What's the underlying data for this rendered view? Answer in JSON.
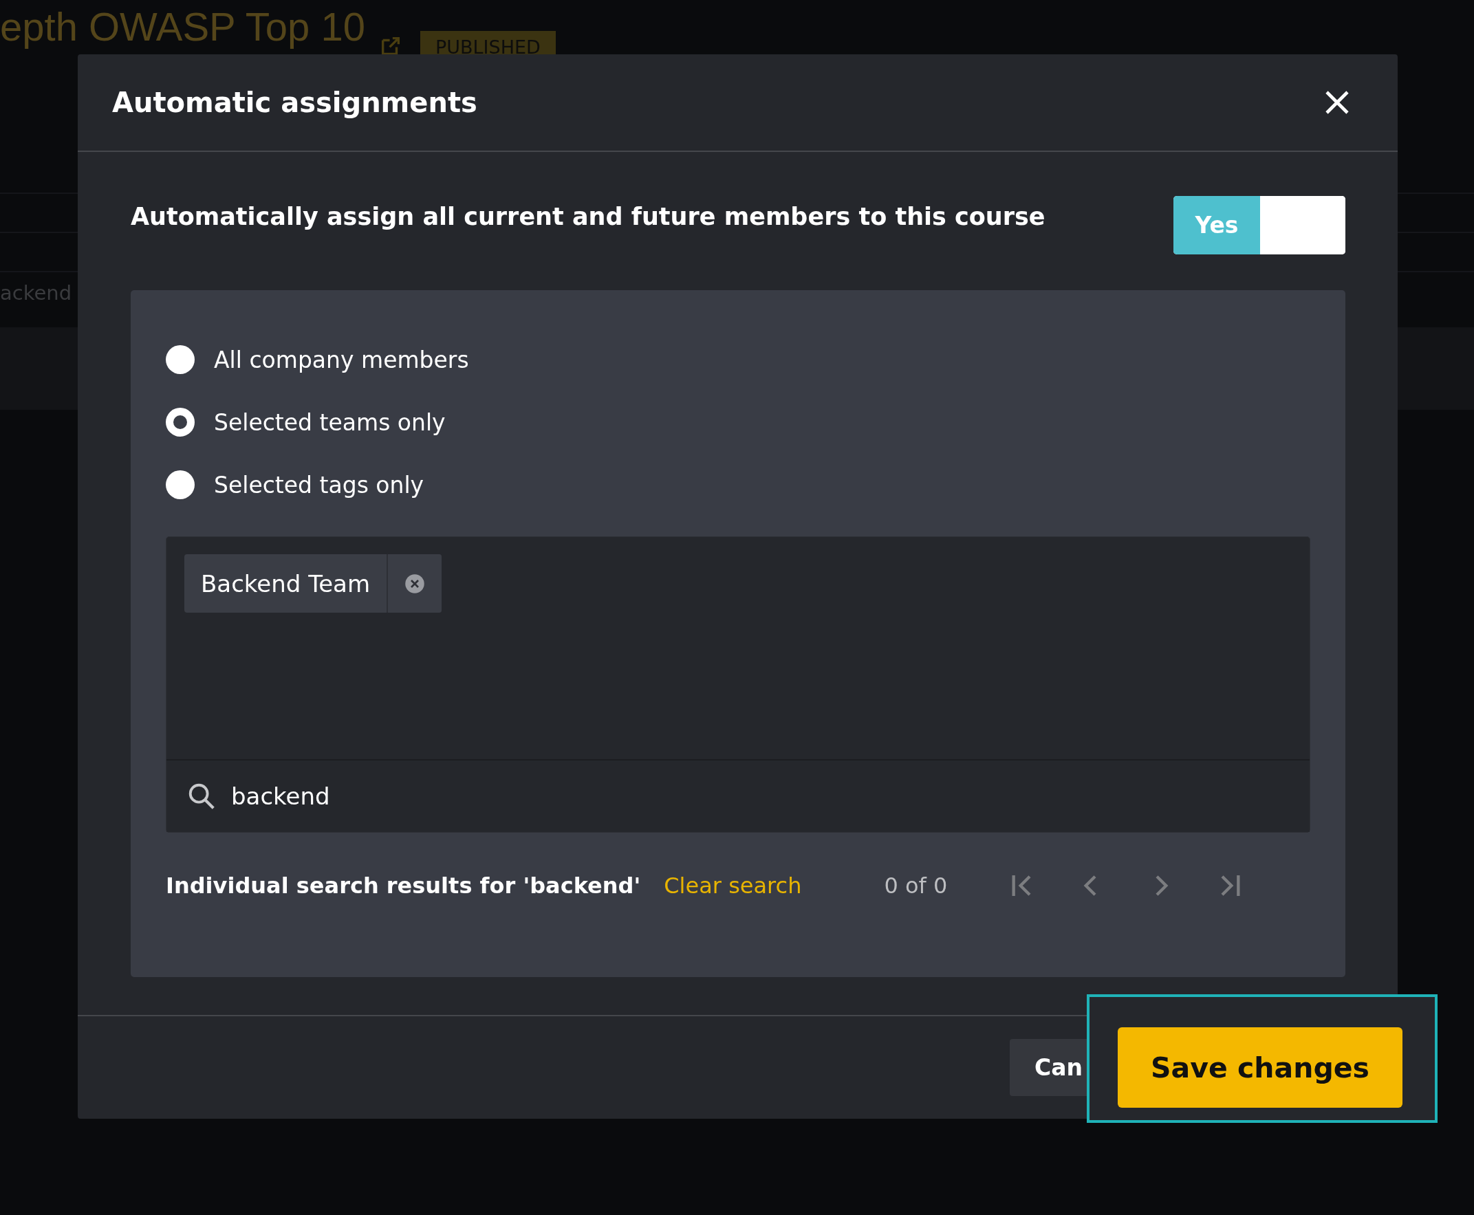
{
  "background_page": {
    "title": "epth OWASP Top 10",
    "status_badge": "PUBLISHED",
    "row_label": "ackend"
  },
  "modal": {
    "title": "Automatic assignments",
    "auto_assign": {
      "label": "Automatically assign all current and future members to this course",
      "toggle": {
        "label": "Yes",
        "on": true
      }
    },
    "options": [
      {
        "label": "All company members",
        "selected": false
      },
      {
        "label": "Selected teams only",
        "selected": true
      },
      {
        "label": "Selected tags only",
        "selected": false
      }
    ],
    "selected_teams": [
      {
        "label": "Backend Team"
      }
    ],
    "search": {
      "value": "backend"
    },
    "results": {
      "heading": "Individual search results for 'backend'",
      "clear_link": "Clear search",
      "count": "0 of 0"
    },
    "footer": {
      "cancel": "Can",
      "save": "Save changes",
      "save_highlighted": true
    }
  }
}
